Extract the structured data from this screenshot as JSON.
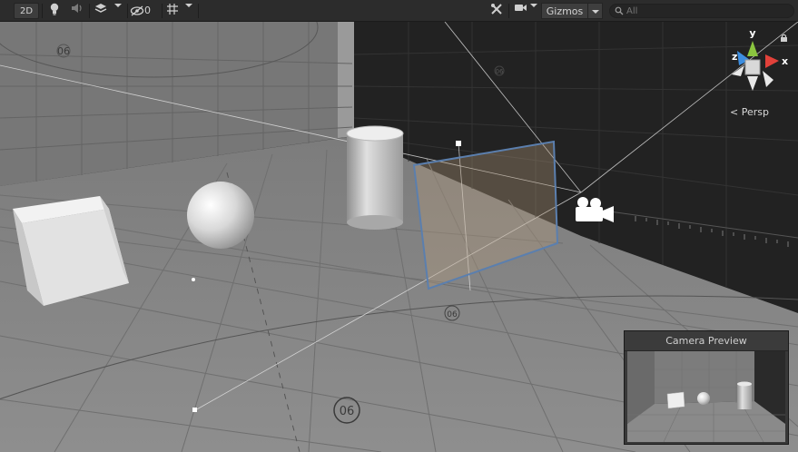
{
  "toolbar": {
    "mode_2d_label": "2D",
    "hidden_count": "0",
    "gizmos_label": "Gizmos",
    "search_placeholder": "All"
  },
  "orientation_gizmo": {
    "axis_x": "x",
    "axis_y": "y",
    "axis_z": "z",
    "projection_label": "< Persp"
  },
  "scene": {
    "grid_markers": [
      "06",
      "06",
      "06",
      "06"
    ]
  },
  "camera_preview": {
    "title": "Camera Preview"
  },
  "colors": {
    "toolbar_bg": "#2c2c2c",
    "floor": "#8a8a8a",
    "camera_frustum": "#5b7fae",
    "axis_x": "#e2413a",
    "axis_y": "#8bc53f",
    "axis_z": "#3d8ee0"
  }
}
